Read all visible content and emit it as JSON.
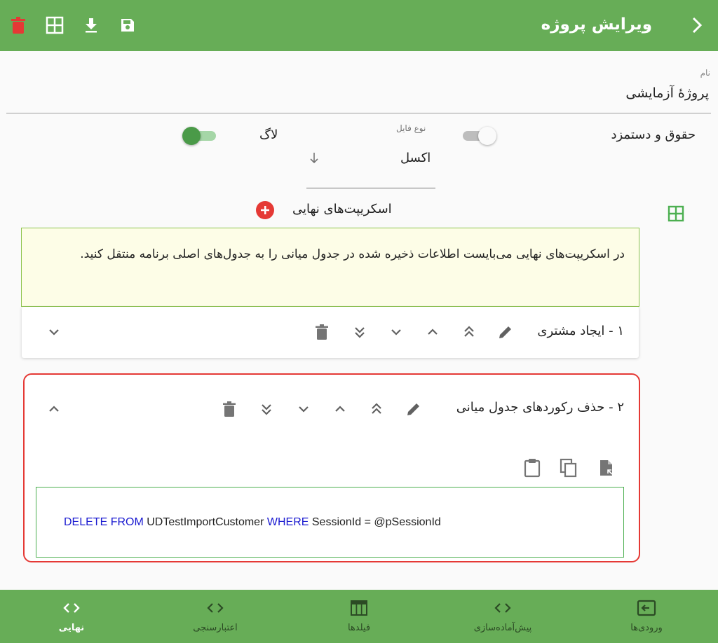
{
  "header": {
    "title": "ویرایش پروژه",
    "icons": [
      "chevron-right-icon",
      "save-icon",
      "download-icon",
      "grid-icon",
      "delete-icon"
    ]
  },
  "form": {
    "name_label": "نام",
    "name_value": "پروژهٔ آزمایشی",
    "wage_label": "حقوق و دستمزد",
    "wage_toggle": "off",
    "filetype_label": "نوع فایل",
    "filetype_value": "اکسل",
    "log_label": "لاگ",
    "log_toggle": "on"
  },
  "scripts": {
    "section_title": "اسکریپت‌های نهایی",
    "info_text": "در اسکریپت‌های نهایی می‌بایست اطلاعات ذخیره شده در جدول میانی را به جدول‌های اصلی برنامه منتقل کنید.",
    "items": [
      {
        "title": "۱ - ایجاد مشتری",
        "expanded": false
      },
      {
        "title": "۲ - حذف رکوردهای جدول میانی",
        "expanded": true
      }
    ],
    "code": {
      "kw1": "DELETE FROM",
      "table": "UDTestImportCustomer",
      "kw2": "WHERE",
      "condition": "SessionId = @pSessionId"
    }
  },
  "bottom_nav": {
    "items": [
      {
        "label": "نهایی",
        "icon": "code-icon",
        "active": true
      },
      {
        "label": "اعتبارسنجی",
        "icon": "code-icon",
        "active": false
      },
      {
        "label": "فیلدها",
        "icon": "table-icon",
        "active": false
      },
      {
        "label": "پیش‌آماده‌سازی",
        "icon": "code-icon",
        "active": false
      },
      {
        "label": "ورودی‌ها",
        "icon": "input-icon",
        "active": false
      }
    ]
  },
  "colors": {
    "primary_green": "#67ad57",
    "accent_red": "#e53935",
    "info_bg": "#fdfde7",
    "sql_keyword": "#1a1ad0"
  }
}
